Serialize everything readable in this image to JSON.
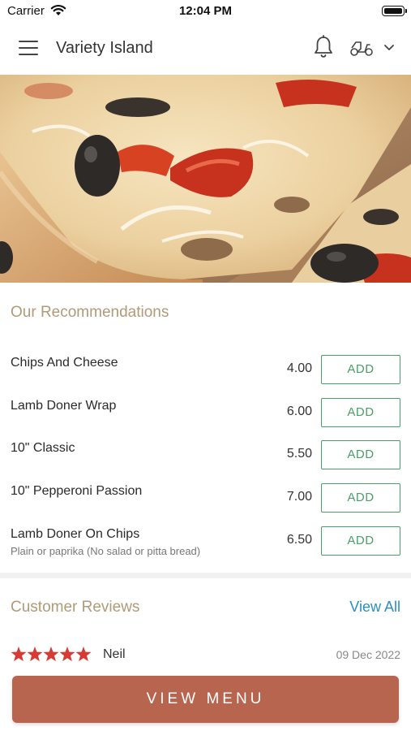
{
  "status_bar": {
    "carrier": "Carrier",
    "time": "12:04 PM"
  },
  "header": {
    "title": "Variety Island"
  },
  "recommendations": {
    "title": "Our Recommendations",
    "items": [
      {
        "name": "Chips And Cheese",
        "subtitle": "",
        "price": "4.00",
        "button": "ADD"
      },
      {
        "name": "Lamb Doner Wrap",
        "subtitle": "",
        "price": "6.00",
        "button": "ADD"
      },
      {
        "name": "10\" Classic",
        "subtitle": "",
        "price": "5.50",
        "button": "ADD"
      },
      {
        "name": "10\" Pepperoni Passion",
        "subtitle": "",
        "price": "7.00",
        "button": "ADD"
      },
      {
        "name": "Lamb Doner On Chips",
        "subtitle": "Plain or paprika (No salad or pitta bread)",
        "price": "6.50",
        "button": "ADD"
      }
    ]
  },
  "reviews": {
    "title": "Customer Reviews",
    "view_all": "View All",
    "items": [
      {
        "rating": 5,
        "name": "Neil",
        "date": "09 Dec 2022"
      }
    ]
  },
  "footer": {
    "view_menu": "VIEW MENU"
  },
  "colors": {
    "accent_gold": "#b09a78",
    "add_green": "#4a9e68",
    "link_blue": "#2a8fc0",
    "star_red": "#d83a34",
    "button_terracotta": "#b86550"
  },
  "icons": [
    "wifi-icon",
    "battery-icon",
    "hamburger-menu-icon",
    "bell-icon",
    "scooter-icon",
    "chevron-down-icon",
    "star-icon"
  ]
}
